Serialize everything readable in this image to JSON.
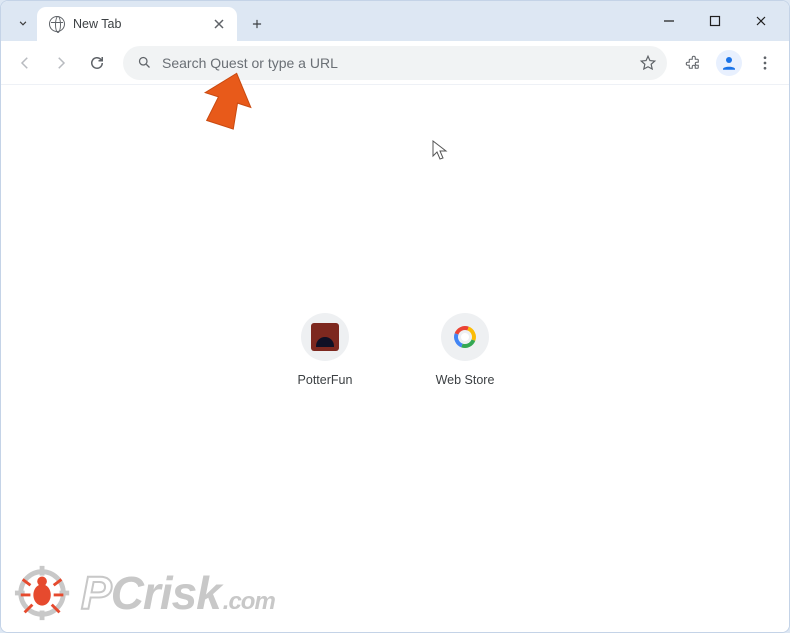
{
  "tab": {
    "title": "New Tab"
  },
  "omnibox": {
    "placeholder": "Search Quest or type a URL",
    "value": ""
  },
  "shortcuts": [
    {
      "label": "PotterFun",
      "icon": "potterfun-tile"
    },
    {
      "label": "Web Store",
      "icon": "webstore-icon"
    }
  ],
  "icons": {
    "tab_dropdown": "chevron-down",
    "tab_favicon": "globe",
    "tab_close": "close",
    "new_tab": "plus",
    "minimize": "minimize",
    "maximize": "maximize",
    "close_window": "close",
    "back": "arrow-left",
    "forward": "arrow-right",
    "reload": "reload",
    "search": "magnifier",
    "bookmark": "star-outline",
    "extensions": "puzzle-piece",
    "profile": "person",
    "menu": "dots-vertical"
  },
  "watermark": {
    "brand_p": "P",
    "brand_c": "C",
    "brand_rest": "risk",
    "tld": ".com"
  }
}
